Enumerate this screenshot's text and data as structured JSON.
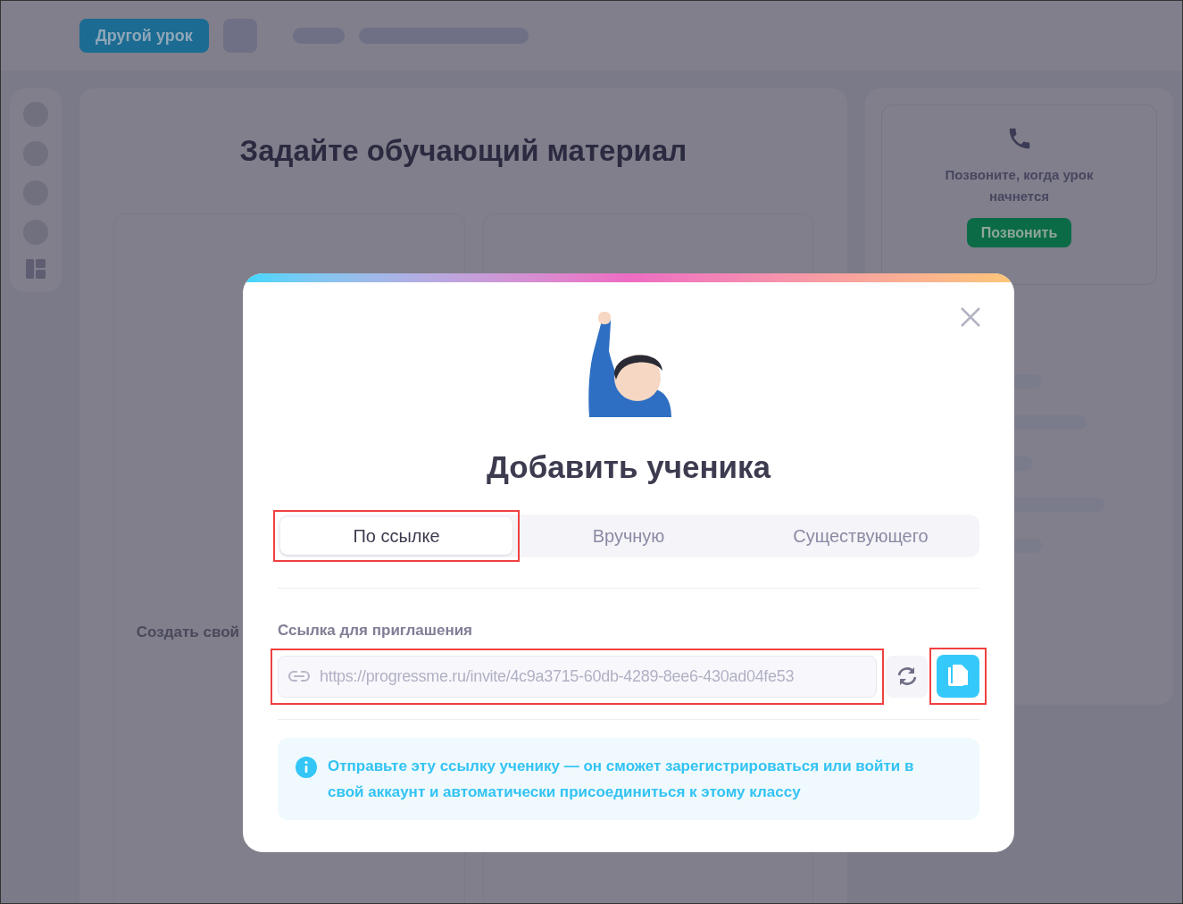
{
  "top_bar": {
    "button": "Другой урок"
  },
  "main_panel": {
    "title": "Задайте обучающий материал",
    "card_text": "Создать свой"
  },
  "call_card": {
    "text": "Позвоните, когда урок начнется",
    "button": "Позвонить"
  },
  "dialog": {
    "title": "Добавить ученика",
    "tabs": [
      {
        "label": "По ссылке",
        "selected": true,
        "highlighted": true
      },
      {
        "label": "Вручную",
        "selected": false,
        "highlighted": false
      },
      {
        "label": "Существующего",
        "selected": false,
        "highlighted": false
      }
    ],
    "link": {
      "label": "Ссылка для приглашения",
      "value": "https://progressme.ru/invite/4c9a3715-60db-4289-8ee6-430ad04fe53",
      "highlighted": true
    },
    "copy_button": {
      "highlighted": true
    },
    "info": "Отправьте эту ссылку ученику — он сможет зарегистрироваться или войти в свой аккаунт и автоматически присоединиться к этому классу"
  }
}
